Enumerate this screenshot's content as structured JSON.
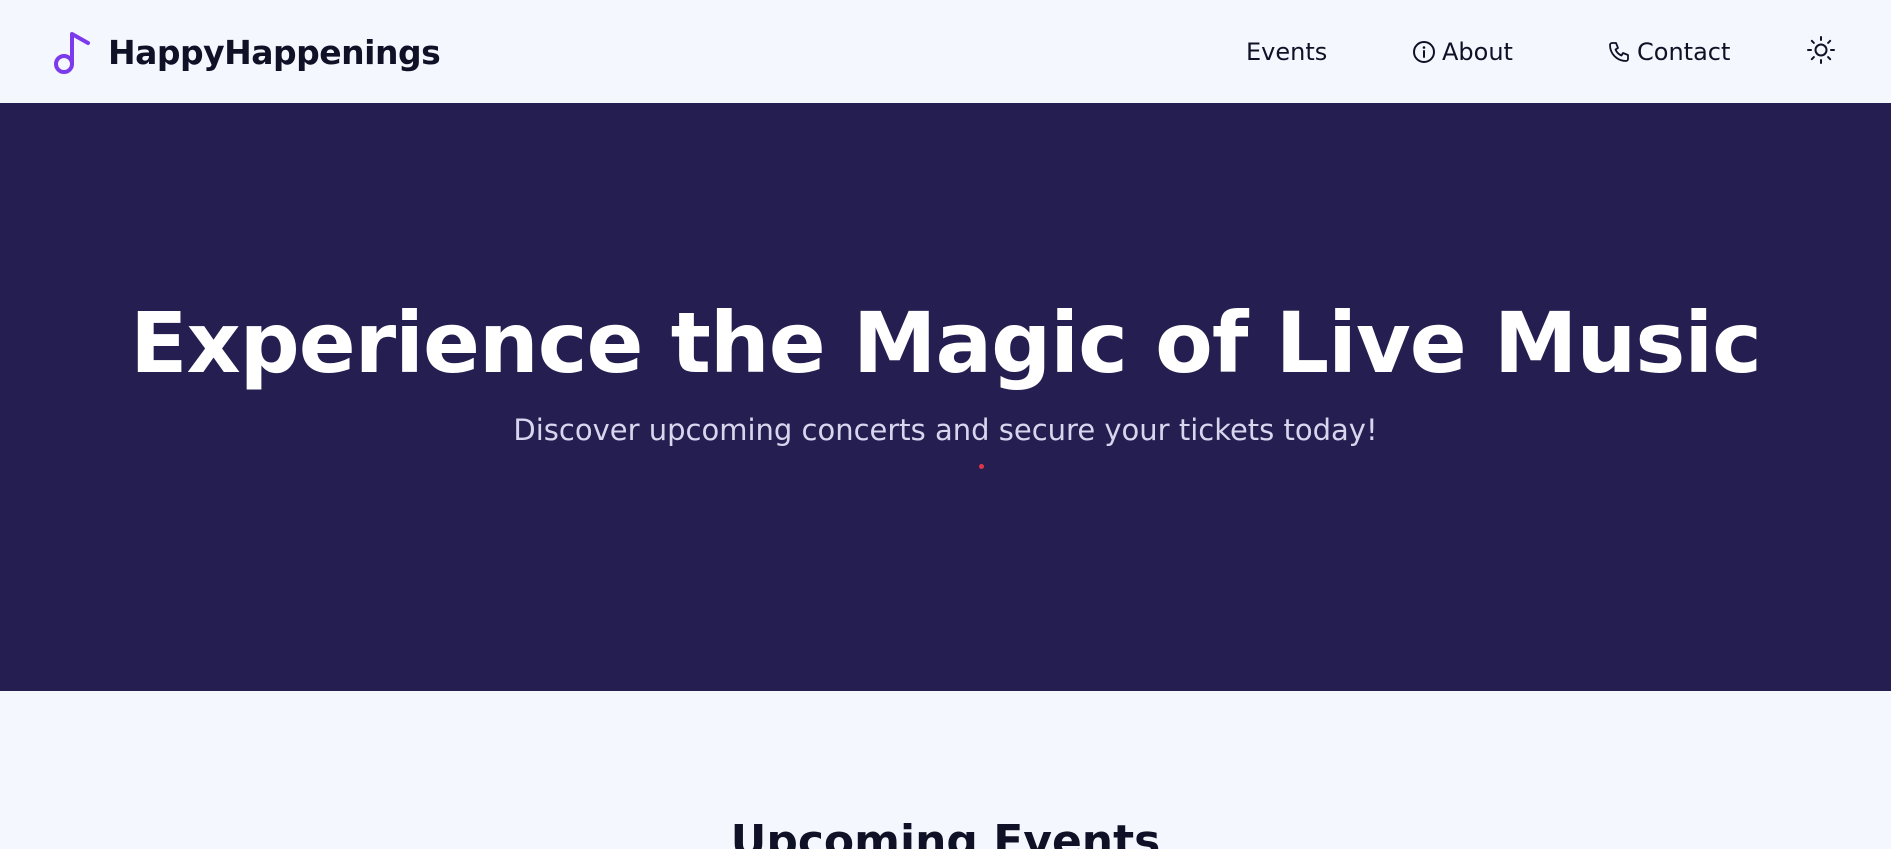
{
  "brand": {
    "name": "HappyHappenings",
    "icon": "music-note-icon"
  },
  "nav": {
    "items": [
      {
        "label": "Events",
        "icon": ""
      },
      {
        "label": "About",
        "icon": "info-icon"
      },
      {
        "label": "Contact",
        "icon": "phone-icon"
      }
    ],
    "theme_toggle_icon": "sun-icon"
  },
  "hero": {
    "title": "Experience the Magic of Live Music",
    "subtitle": "Discover upcoming concerts and secure your tickets today!"
  },
  "events": {
    "title": "Upcoming Events"
  },
  "colors": {
    "accent": "#7c3aed",
    "hero_background": "#251f51",
    "page_background": "#f4f7fe",
    "text_dark": "#0f1226",
    "hero_dot": "#e0344a"
  }
}
